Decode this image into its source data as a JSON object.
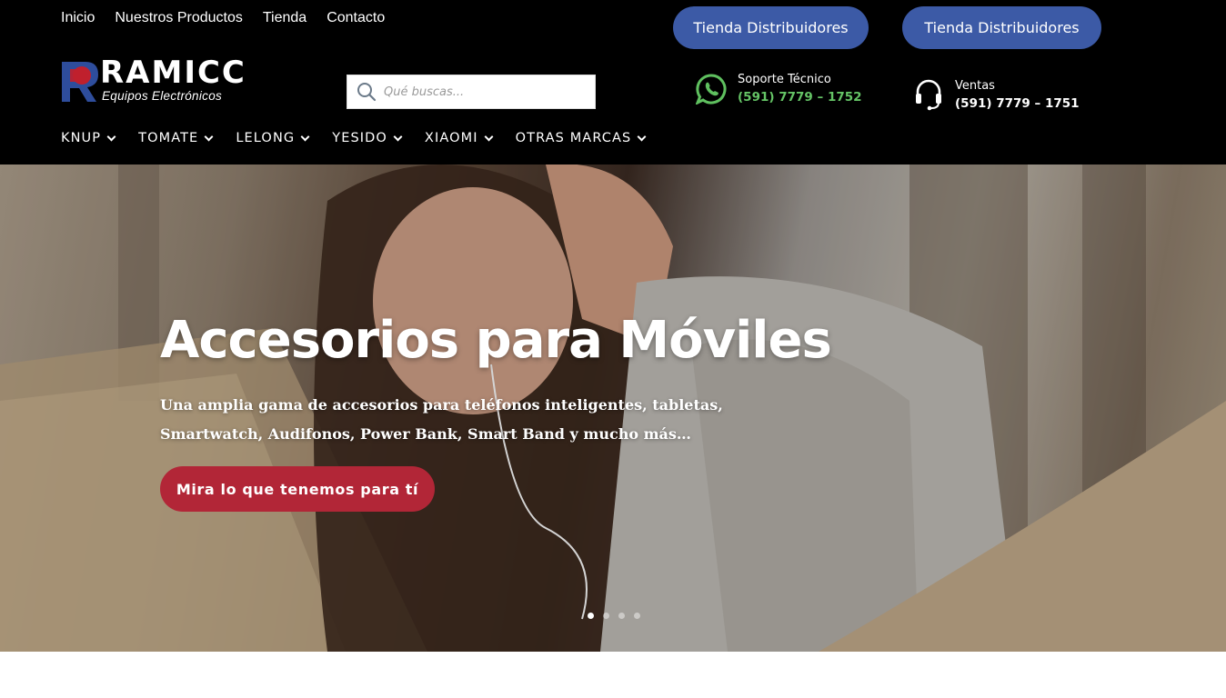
{
  "top_nav": {
    "items": [
      "Inicio",
      "Nuestros Productos",
      "Tienda",
      "Contacto"
    ]
  },
  "distributor_buttons": [
    "Tienda Distribuidores",
    "Tienda Distribuidores"
  ],
  "logo": {
    "wordmark": "RAMICC",
    "tagline": "Equipos Electrónicos",
    "colors": {
      "mark_red": "#c0202e",
      "mark_blue": "#2e4d9c"
    }
  },
  "search": {
    "placeholder": "Qué buscas..."
  },
  "support": {
    "icon": "whatsapp-icon",
    "label": "Soporte Técnico",
    "phone": "(591) 7779 – 1752",
    "phone_color": "#65c466"
  },
  "sales": {
    "icon": "headset-icon",
    "label": "Ventas",
    "phone": "(591) 7779 – 1751"
  },
  "brand_nav": {
    "items": [
      "KNUP",
      "TOMATE",
      "LELONG",
      "YESIDO",
      "XIAOMI",
      "OTRAS MARCAS"
    ]
  },
  "hero": {
    "title": "Accesorios para Móviles",
    "text_line1": "Una amplia gama de accesorios para teléfonos inteligentes, tabletas,",
    "text_line2": "Smartwatch,  Audifonos, Power Bank, Smart Band y mucho más…",
    "cta": "Mira lo que tenemos para tí",
    "cta_color": "#b22637",
    "slides": 4,
    "active_slide": 1
  },
  "colors": {
    "header_bg": "#000000",
    "distributor_button": "#3c5aa6"
  }
}
